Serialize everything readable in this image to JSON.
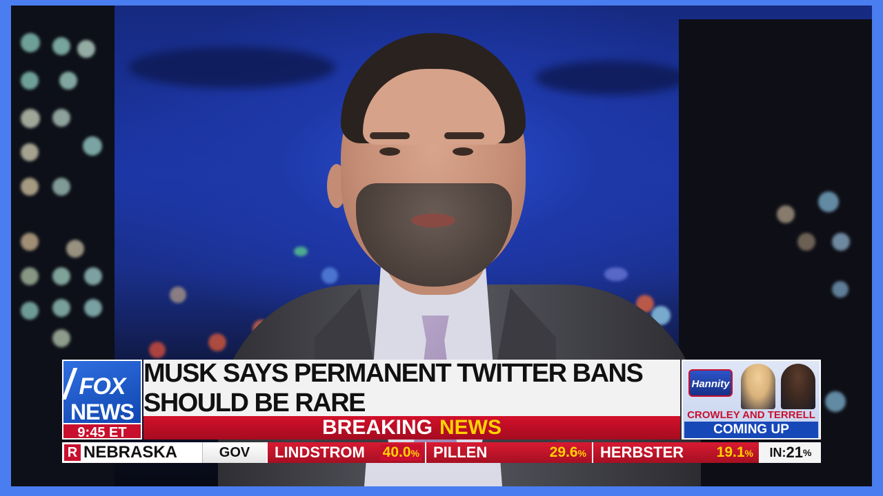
{
  "broadcast": {
    "network_logo": {
      "line1": "FOX",
      "line2": "NEWS"
    },
    "time": "9:45 ET",
    "headline": "MUSK SAYS PERMANENT TWITTER BANS SHOULD BE RARE",
    "banner": {
      "word1": "BREAKING",
      "word2": "NEWS"
    },
    "promo": {
      "show_logo": "Hannity",
      "hosts_text": "CROWLEY AND TERRELL",
      "coming_up": "COMING UP"
    },
    "ticker": {
      "party_badge": "R",
      "state": "NEBRASKA",
      "office": "GOV",
      "candidates": [
        {
          "name": "LINDSTROM",
          "pct_value": "40.0",
          "pct_sign": "%"
        },
        {
          "name": "PILLEN",
          "pct_value": "29.6",
          "pct_sign": "%"
        },
        {
          "name": "HERBSTER",
          "pct_value": "19.1",
          "pct_sign": "%"
        }
      ],
      "reporting": {
        "label": "IN:",
        "value": "21",
        "sign": "%"
      }
    }
  },
  "colors": {
    "frame_border": "#4a7df0",
    "fox_red": "#c8102e",
    "fox_blue": "#1748b8",
    "breaking_yellow": "#ffd200"
  }
}
